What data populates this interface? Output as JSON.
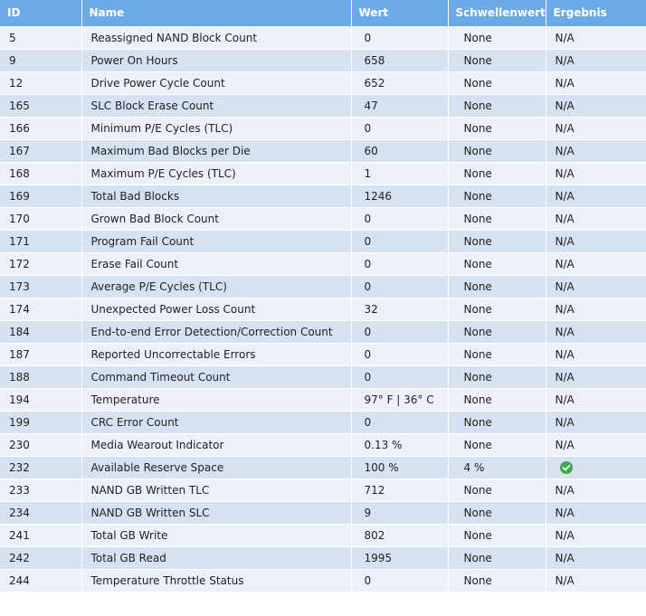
{
  "table": {
    "headers": {
      "id": "ID",
      "name": "Name",
      "value": "Wert",
      "threshold": "Schwellenwert",
      "result": "Ergebnis"
    },
    "rows": [
      {
        "id": "5",
        "name": "Reassigned NAND Block Count",
        "value": "0",
        "threshold": "None",
        "result": "N/A"
      },
      {
        "id": "9",
        "name": "Power On Hours",
        "value": "658",
        "threshold": "None",
        "result": "N/A"
      },
      {
        "id": "12",
        "name": "Drive Power Cycle Count",
        "value": "652",
        "threshold": "None",
        "result": "N/A"
      },
      {
        "id": "165",
        "name": "SLC Block Erase Count",
        "value": "47",
        "threshold": "None",
        "result": "N/A"
      },
      {
        "id": "166",
        "name": "Minimum P/E Cycles (TLC)",
        "value": "0",
        "threshold": "None",
        "result": "N/A"
      },
      {
        "id": "167",
        "name": "Maximum Bad Blocks per Die",
        "value": "60",
        "threshold": "None",
        "result": "N/A"
      },
      {
        "id": "168",
        "name": "Maximum P/E Cycles (TLC)",
        "value": "1",
        "threshold": "None",
        "result": "N/A"
      },
      {
        "id": "169",
        "name": "Total Bad Blocks",
        "value": "1246",
        "threshold": "None",
        "result": "N/A"
      },
      {
        "id": "170",
        "name": "Grown Bad Block Count",
        "value": "0",
        "threshold": "None",
        "result": "N/A"
      },
      {
        "id": "171",
        "name": "Program Fail Count",
        "value": "0",
        "threshold": "None",
        "result": "N/A"
      },
      {
        "id": "172",
        "name": "Erase Fail Count",
        "value": "0",
        "threshold": "None",
        "result": "N/A"
      },
      {
        "id": "173",
        "name": "Average P/E Cycles (TLC)",
        "value": "0",
        "threshold": "None",
        "result": "N/A"
      },
      {
        "id": "174",
        "name": "Unexpected Power Loss Count",
        "value": "32",
        "threshold": "None",
        "result": "N/A"
      },
      {
        "id": "184",
        "name": "End-to-end Error Detection/Correction Count",
        "value": "0",
        "threshold": "None",
        "result": "N/A"
      },
      {
        "id": "187",
        "name": "Reported Uncorrectable Errors",
        "value": "0",
        "threshold": "None",
        "result": "N/A"
      },
      {
        "id": "188",
        "name": "Command Timeout Count",
        "value": "0",
        "threshold": "None",
        "result": "N/A"
      },
      {
        "id": "194",
        "name": "Temperature",
        "value": "97° F | 36° C",
        "threshold": "None",
        "result": "N/A"
      },
      {
        "id": "199",
        "name": "CRC Error Count",
        "value": "0",
        "threshold": "None",
        "result": "N/A"
      },
      {
        "id": "230",
        "name": "Media Wearout Indicator",
        "value": "0.13 %",
        "threshold": "None",
        "result": "N/A"
      },
      {
        "id": "232",
        "name": "Available Reserve Space",
        "value": "100 %",
        "threshold": "4 %",
        "result": "",
        "result_icon": "check-circle-icon"
      },
      {
        "id": "233",
        "name": "NAND GB Written TLC",
        "value": "712",
        "threshold": "None",
        "result": "N/A"
      },
      {
        "id": "234",
        "name": "NAND GB Written SLC",
        "value": "9",
        "threshold": "None",
        "result": "N/A"
      },
      {
        "id": "241",
        "name": "Total GB Write",
        "value": "802",
        "threshold": "None",
        "result": "N/A"
      },
      {
        "id": "242",
        "name": "Total GB Read",
        "value": "1995",
        "threshold": "None",
        "result": "N/A"
      },
      {
        "id": "244",
        "name": "Temperature Throttle Status",
        "value": "0",
        "threshold": "None",
        "result": "N/A"
      }
    ]
  },
  "colors": {
    "header_bg": "#6aaae6",
    "row_light": "#ebf0f9",
    "row_dark": "#d6e1f2",
    "ok_green": "#3cab4a"
  }
}
